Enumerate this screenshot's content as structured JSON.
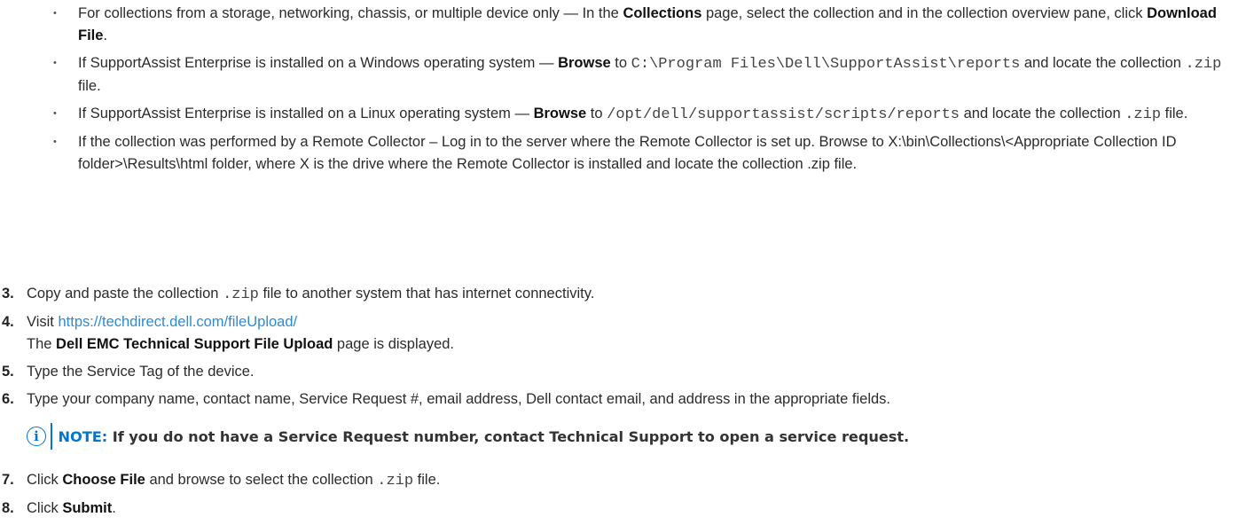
{
  "bullet_marker": "•",
  "bullets": [
    {
      "t1": "For collections from a storage, networking, chassis, or multiple device only — In the ",
      "b1": "Collections",
      "t2": " page, select the collection and in the collection overview pane, click ",
      "b2": "Download File",
      "t3": "."
    },
    {
      "t1": "If SupportAssist Enterprise is installed on a Windows operating system — ",
      "b1": "Browse",
      "t2": " to ",
      "code": "C:\\Program Files\\Dell\\SupportAssist\\reports",
      "t3": " and locate the collection ",
      "code2": ".zip",
      "t4": " file."
    },
    {
      "t1": "If SupportAssist Enterprise is installed on a Linux operating system — ",
      "b1": "Browse",
      "t2": " to ",
      "code": "/opt/dell/supportassist/scripts/reports",
      "t3": " and locate the collection ",
      "code2": ".zip",
      "t4": " file."
    },
    {
      "text": "If the collection was performed by a Remote Collector – Log in to the server where the Remote Collector is set up. Browse to X:\\bin\\Collections\\<Appropriate Collection ID folder>\\Results\\html folder, where X is the drive where the Remote Collector is installed and locate the collection .zip file."
    }
  ],
  "steps": {
    "s3": {
      "num": "3.",
      "t1": "Copy and paste the collection ",
      "code": ".zip",
      "t2": " file to another system that has internet connectivity."
    },
    "s4": {
      "num": "4.",
      "t1": "Visit ",
      "link": "https://techdirect.dell.com/fileUpload/",
      "line2_pre": "The ",
      "line2_bold": "Dell EMC Technical Support File Upload",
      "line2_post": " page is displayed."
    },
    "s5": {
      "num": "5.",
      "text": "Type the Service Tag of the device."
    },
    "s6": {
      "num": "6.",
      "text": "Type your company name, contact name, Service Request #, email address, Dell contact email, and address in the appropriate fields."
    },
    "s7": {
      "num": "7.",
      "t1": "Click ",
      "b1": "Choose File",
      "t2": " and browse to select the collection ",
      "code": ".zip",
      "t3": " file."
    },
    "s8": {
      "num": "8.",
      "t1": "Click ",
      "b1": "Submit",
      "t2": "."
    }
  },
  "note": {
    "icon": "i",
    "label": "NOTE:",
    "text": " If you do not have a Service Request number, contact Technical Support to open a service request."
  },
  "colors": {
    "accent": "#0076ce",
    "link": "#2a8bd6",
    "text": "#2b2b2b"
  }
}
